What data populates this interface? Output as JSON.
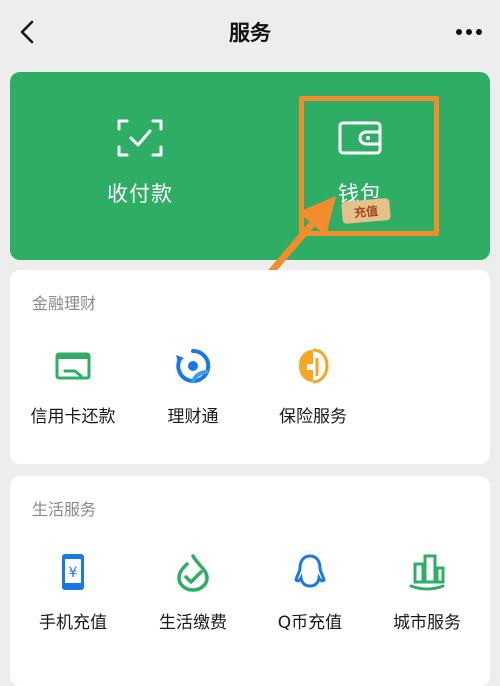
{
  "header": {
    "title": "服务"
  },
  "top_card": {
    "items": [
      {
        "label": "收付款",
        "icon": "scan-check-icon"
      },
      {
        "label": "钱包",
        "icon": "wallet-icon"
      }
    ],
    "stamp_text": "充值"
  },
  "finance": {
    "title": "金融理财",
    "items": [
      {
        "label": "信用卡还款",
        "icon": "credit-card-icon"
      },
      {
        "label": "理财通",
        "icon": "wealth-icon"
      },
      {
        "label": "保险服务",
        "icon": "insurance-icon"
      }
    ]
  },
  "life": {
    "title": "生活服务",
    "items": [
      {
        "label": "手机充值",
        "icon": "phone-recharge-icon"
      },
      {
        "label": "生活缴费",
        "icon": "utility-payment-icon"
      },
      {
        "label": "Q币充值",
        "icon": "qq-coin-icon"
      },
      {
        "label": "城市服务",
        "icon": "city-service-icon"
      }
    ]
  },
  "colors": {
    "brand_green": "#2dae64",
    "highlight_orange": "#f28c2c",
    "icon_blue": "#1a78e6",
    "icon_green": "#2dae64",
    "icon_orange": "#f5a623"
  }
}
